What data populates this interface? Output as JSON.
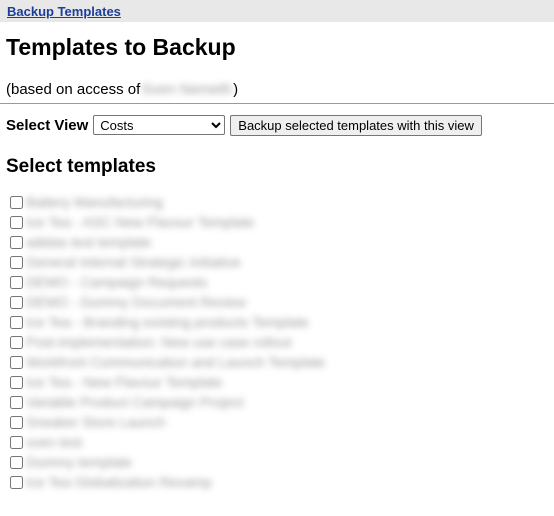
{
  "topbar": {
    "breadcrumb_link": "Backup Templates"
  },
  "page": {
    "title": "Templates to Backup",
    "access_prefix": "(based on access of ",
    "access_user": "Sven Nemeth",
    "access_suffix": ")"
  },
  "view": {
    "label": "Select View",
    "selected": "Costs",
    "options": [
      "Costs"
    ],
    "button_label": "Backup selected templates with this view"
  },
  "templates": {
    "heading": "Select templates",
    "items": [
      "Battery Manufacturing",
      "Ice Tea - ASC New Flavour Template",
      "adidas test template",
      "General Internal Strategic Initiative",
      "DEMO - Campaign Requests",
      "DEMO - Dummy Document Review",
      "Ice Tea - Branding existing products Template",
      "Post-implementation: New use case rollout",
      "Workfront Communication and Launch Template",
      "Ice Tea - New Flavour Template",
      "Variable Product Campaign Project",
      "Sneaker Store Launch",
      "sven test",
      "Dummy template",
      "Ice Tea Globalization Revamp"
    ]
  }
}
